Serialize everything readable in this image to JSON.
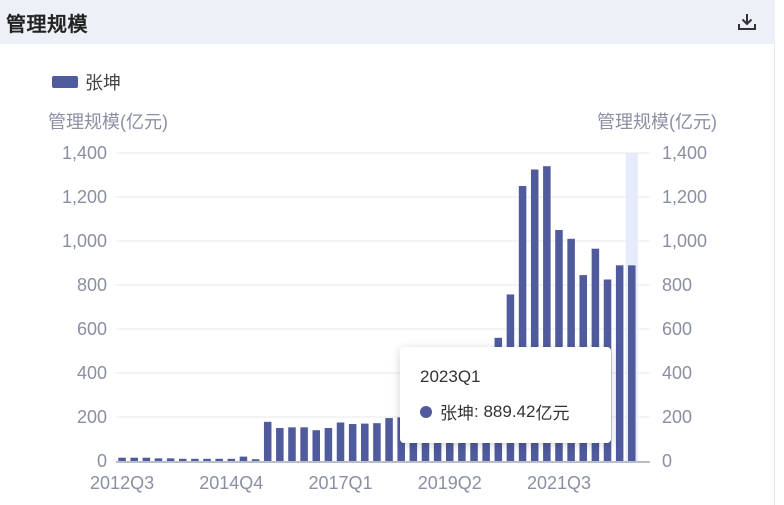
{
  "header": {
    "title": "管理规模"
  },
  "chart_data": {
    "type": "bar",
    "left_axis_label": "管理规模(亿元)",
    "right_axis_label": "管理规模(亿元)",
    "ylim": [
      0,
      1400
    ],
    "y_ticks": [
      "1,400",
      "1,200",
      "1,000",
      "800",
      "600",
      "400",
      "200",
      "0"
    ],
    "x_tick_labels": [
      "2012Q3",
      "2014Q4",
      "2017Q1",
      "2019Q2",
      "2021Q3"
    ],
    "categories": [
      "2012Q3",
      "2012Q4",
      "2013Q1",
      "2013Q2",
      "2013Q3",
      "2013Q4",
      "2014Q1",
      "2014Q2",
      "2014Q3",
      "2014Q4",
      "2015Q1",
      "2015Q2",
      "2015Q3",
      "2015Q4",
      "2016Q1",
      "2016Q2",
      "2016Q3",
      "2016Q4",
      "2017Q1",
      "2017Q2",
      "2017Q3",
      "2017Q4",
      "2018Q1",
      "2018Q2",
      "2018Q3",
      "2018Q4",
      "2019Q1",
      "2019Q2",
      "2019Q3",
      "2019Q4",
      "2020Q1",
      "2020Q2",
      "2020Q3",
      "2020Q4",
      "2021Q1",
      "2021Q2",
      "2021Q3",
      "2021Q4",
      "2022Q1",
      "2022Q2",
      "2022Q3",
      "2022Q4",
      "2023Q1",
      "2023Q2"
    ],
    "series": [
      {
        "name": "张坤",
        "color": "#4f5b9d",
        "values": [
          15,
          15,
          15,
          12,
          12,
          10,
          10,
          10,
          10,
          10,
          20,
          8,
          178,
          150,
          153,
          153,
          140,
          150,
          175,
          168,
          170,
          172,
          195,
          198,
          190,
          250,
          290,
          335,
          360,
          300,
          380,
          560,
          757,
          1250,
          1325,
          1340,
          1050,
          1010,
          845,
          965,
          825,
          889.42,
          889.42,
          0
        ]
      }
    ],
    "highlight_category": "2023Q1",
    "grid": true,
    "legend_position": "top-left"
  },
  "tooltip": {
    "title": "2023Q1",
    "series_name": "张坤",
    "value": "889.42",
    "unit": "亿元"
  }
}
